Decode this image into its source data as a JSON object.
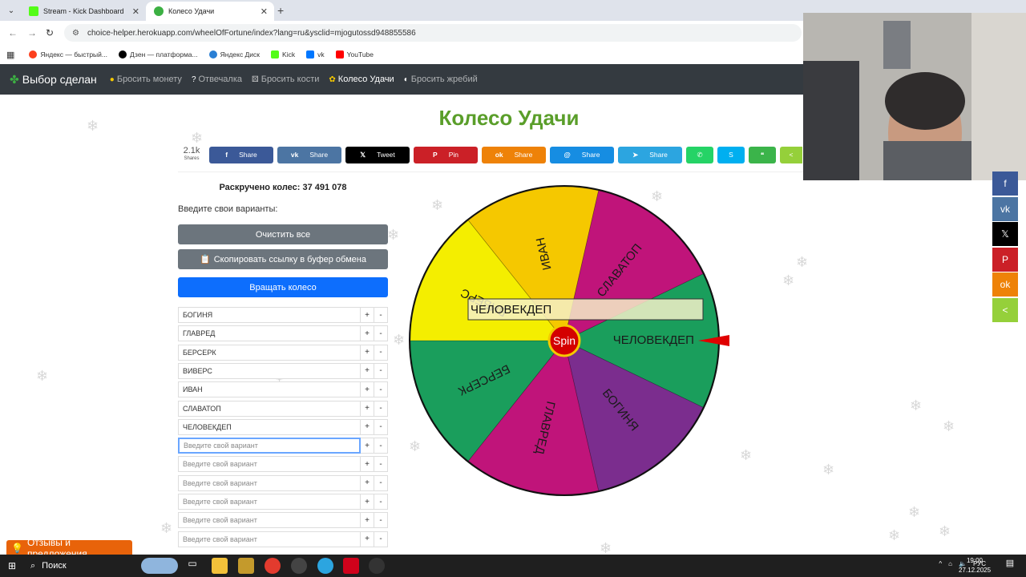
{
  "browser": {
    "tabs": [
      {
        "title": "Stream - Kick Dashboard",
        "active": false,
        "favicon_color": "#53fc18"
      },
      {
        "title": "Колесо Удачи",
        "active": true,
        "favicon_color": "#3cb043"
      }
    ],
    "url": "choice-helper.herokuapp.com/wheelOfFortune/index?lang=ru&ysclid=mjogutossd948855586",
    "bookmarks": [
      {
        "label": "Яндекс — быстрый...",
        "color": "#fc3f1d"
      },
      {
        "label": "Дзен — платформа...",
        "color": "#000000"
      },
      {
        "label": "Яндекс Диск",
        "color": "#2a7fd4"
      },
      {
        "label": "Kick",
        "color": "#53fc18"
      },
      {
        "label": "vk",
        "color": "#0077ff"
      },
      {
        "label": "YouTube",
        "color": "#ff0000"
      }
    ]
  },
  "navbar": {
    "brand": "Выбор сделан",
    "links": [
      {
        "label": "Бросить монету",
        "active": false
      },
      {
        "label": "Отвечалка",
        "active": false
      },
      {
        "label": "Бросить кости",
        "active": false
      },
      {
        "label": "Колесо Удачи",
        "active": true
      },
      {
        "label": "Бросить жребий",
        "active": false
      }
    ]
  },
  "page": {
    "title": "Колесо Удачи",
    "share": {
      "count": "2.1k",
      "count_label": "Shares",
      "buttons": [
        {
          "label": "Share",
          "icon": "f",
          "color": "#3b5998"
        },
        {
          "label": "Share",
          "icon": "vk",
          "color": "#4c75a3"
        },
        {
          "label": "Tweet",
          "icon": "𝕏",
          "color": "#000000"
        },
        {
          "label": "Pin",
          "icon": "P",
          "color": "#cb2027"
        },
        {
          "label": "Share",
          "icon": "ok",
          "color": "#ee8208"
        },
        {
          "label": "Share",
          "icon": "@",
          "color": "#168de2"
        },
        {
          "label": "Share",
          "icon": "➤",
          "color": "#2ca5e0"
        }
      ],
      "small_buttons": [
        {
          "icon": "✆",
          "color": "#25d366"
        },
        {
          "icon": "S",
          "color": "#00aff0"
        },
        {
          "icon": "❝",
          "color": "#3bb44a"
        },
        {
          "icon": "<",
          "color": "#95d03a"
        }
      ]
    },
    "spin_counter": "Раскручено колес: 37 491 078",
    "prompt": "Введите свои варианты:",
    "clear_button": "Очистить все",
    "copy_button": "Скопировать ссылку в буфер обмена",
    "spin_button": "Вращать колесо",
    "plus": "+",
    "minus": "-",
    "options": [
      "БОГИНЯ",
      "ГЛАВРЕД",
      "БЕРСЕРК",
      "ВИВЕРС",
      "ИВАН",
      "СЛАВАТОП",
      "ЧЕЛОВЕКДЕП"
    ],
    "placeholder": "Введите свой вариант",
    "empty_rows": 6,
    "feedback": "Отзывы и предложения"
  },
  "wheel": {
    "center_label": "Spin",
    "result_label": "ЧЕЛОВЕКДЕП",
    "segments": [
      {
        "label": "ЧЕЛОВЕКДЕП",
        "color": "#1a9e5c"
      },
      {
        "label": "БОГИНЯ",
        "color": "#7b2d8e"
      },
      {
        "label": "ГЛАВРЕД",
        "color": "#c0147a"
      },
      {
        "label": "БЕРСЕРК",
        "color": "#1a9e5c"
      },
      {
        "label": "ВИВЕРС",
        "color": "#f4ee00"
      },
      {
        "label": "ИВАН",
        "color": "#f5c800"
      },
      {
        "label": "СЛАВАТОП",
        "color": "#c0147a"
      }
    ]
  },
  "side_share": [
    {
      "icon": "f",
      "color": "#3b5998"
    },
    {
      "icon": "vk",
      "color": "#4c75a3"
    },
    {
      "icon": "𝕏",
      "color": "#000000"
    },
    {
      "icon": "P",
      "color": "#cb2027"
    },
    {
      "icon": "ok",
      "color": "#ee8208"
    },
    {
      "icon": "<",
      "color": "#95d03a"
    }
  ],
  "taskbar": {
    "search": "Поиск",
    "language": "РУС",
    "time": "19:00",
    "date": "27.12.2025"
  }
}
